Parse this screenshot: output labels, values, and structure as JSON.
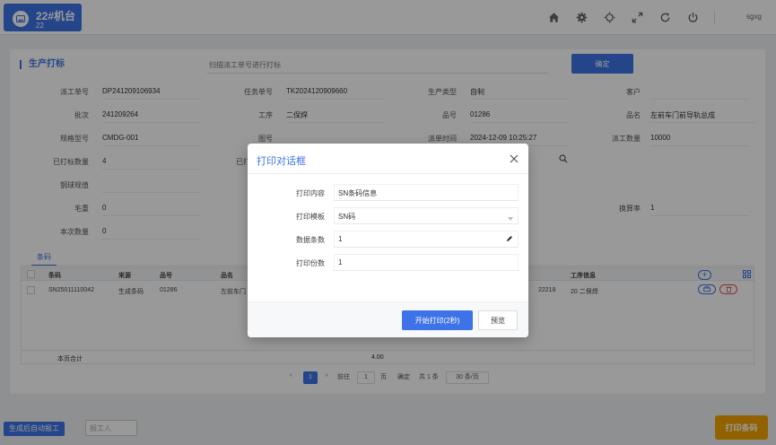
{
  "colors": {
    "primary": "#3d73e6",
    "accent": "#f4a300",
    "overlay": "rgba(0,0,0,0.40)"
  },
  "header": {
    "machine_title": "22#机台",
    "machine_sub": "22",
    "user": "sgxg",
    "icons": [
      "home-icon",
      "gear-icon",
      "theme-icon",
      "fullscreen-icon",
      "refresh-icon",
      "power-icon"
    ]
  },
  "page": {
    "title": "生产打标",
    "scan_placeholder": "扫描派工单号进行打标",
    "confirm_label": "确定"
  },
  "form": {
    "dispatch_no": {
      "label": "派工单号",
      "value": "DP241209106934"
    },
    "task_no": {
      "label": "任务单号",
      "value": "TK2024120909660"
    },
    "prod_type": {
      "label": "生产类型",
      "value": "自制"
    },
    "customer": {
      "label": "客户",
      "value": ""
    },
    "batch": {
      "label": "批次",
      "value": "241209264"
    },
    "process": {
      "label": "工序",
      "value": "二保焊"
    },
    "part_no": {
      "label": "品号",
      "value": "01286"
    },
    "part_name": {
      "label": "品名",
      "value": "左前车门前导轨总成"
    },
    "spec": {
      "label": "规格型号",
      "value": "CMDG-001"
    },
    "drawing_no": {
      "label": "图号",
      "value": ""
    },
    "dispatch_time": {
      "label": "派单时间",
      "value": "2024-12-09 10:25:27"
    },
    "dispatch_qty": {
      "label": "派工数量",
      "value": "10000"
    },
    "printed_qty": {
      "label": "已打标数量",
      "value": "4"
    },
    "printed_partial": {
      "label": "已打"
    },
    "steel_ball": {
      "label": "钢球规值",
      "value": ""
    },
    "gross_weight": {
      "label": "毛重",
      "value": "0"
    },
    "conversion_rate": {
      "label": "换算率",
      "value": "1"
    },
    "current_qty": {
      "label": "本次数量",
      "value": "0"
    }
  },
  "tabs": [
    {
      "label": "条码"
    }
  ],
  "table": {
    "headers": [
      "条码",
      "来源",
      "品号",
      "品名",
      "工序信息"
    ],
    "rows": [
      {
        "barcode": "SN25011110042",
        "source": "生成条码",
        "part_no": "01286",
        "part_name": "左前车门",
        "partial": "22218",
        "process_info": "20 二保焊"
      }
    ],
    "summary_label": "本页合计",
    "summary_value": "4.00"
  },
  "pagination": {
    "prev": "‹",
    "current": "1",
    "next": "›",
    "goto_label": "前往",
    "goto_value": "1",
    "page_unit": "页",
    "confirm": "确定",
    "total": "共 1 条",
    "page_size": "30 条/页"
  },
  "footer": {
    "auto_report_label": "生成后自动报工",
    "reporter_placeholder": "报工人",
    "print_button_label": "打印条码"
  },
  "dialog": {
    "title": "打印对话框",
    "fields": [
      {
        "label": "打印内容",
        "value": "SN条码信息"
      },
      {
        "label": "打印模板",
        "value": "SN码"
      },
      {
        "label": "数据条数",
        "value": "1"
      },
      {
        "label": "打印份数",
        "value": "1"
      }
    ],
    "start_label": "开始打印(2秒)",
    "preview_label": "预览"
  }
}
